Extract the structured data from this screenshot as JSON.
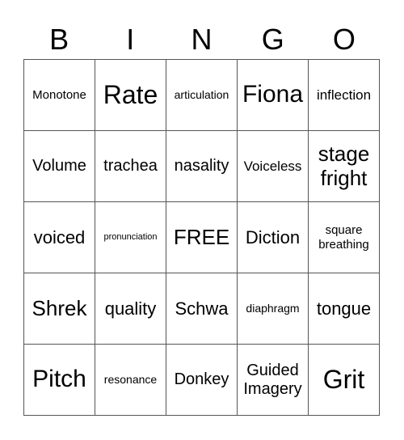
{
  "header": [
    "B",
    "I",
    "N",
    "G",
    "O"
  ],
  "cells": [
    [
      "Monotone",
      "Rate",
      "articulation",
      "Fiona",
      "inflection"
    ],
    [
      "Volume",
      "trachea",
      "nasality",
      "Voiceless",
      "stage fright"
    ],
    [
      "voiced",
      "pronunciation",
      "FREE",
      "Diction",
      "square breathing"
    ],
    [
      "Shrek",
      "quality",
      "Schwa",
      "diaphragm",
      "tongue"
    ],
    [
      "Pitch",
      "resonance",
      "Donkey",
      "Guided Imagery",
      "Grit"
    ]
  ]
}
